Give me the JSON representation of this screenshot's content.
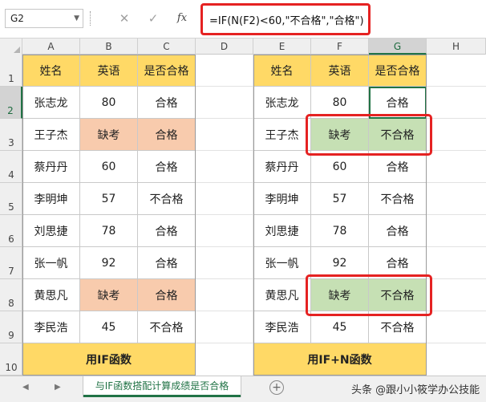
{
  "formula_bar": {
    "name_box": "G2",
    "cancel_glyph": "✕",
    "confirm_glyph": "✓",
    "fx_label": "fx",
    "formula": "=IF(N(F2)<60,\"不合格\",\"合格\")"
  },
  "columns": [
    "A",
    "B",
    "C",
    "D",
    "E",
    "F",
    "G",
    "H"
  ],
  "selected_column": "G",
  "rows": [
    "1",
    "2",
    "3",
    "4",
    "5",
    "6",
    "7",
    "8",
    "9",
    "10"
  ],
  "selected_row": "2",
  "left_table": {
    "headers": [
      "姓名",
      "英语",
      "是否合格"
    ],
    "rows": [
      [
        "张志龙",
        "80",
        "合格"
      ],
      [
        "王子杰",
        "缺考",
        "合格"
      ],
      [
        "蔡丹丹",
        "60",
        "合格"
      ],
      [
        "李明坤",
        "57",
        "不合格"
      ],
      [
        "刘思捷",
        "78",
        "合格"
      ],
      [
        "张一帆",
        "92",
        "合格"
      ],
      [
        "黄思凡",
        "缺考",
        "合格"
      ],
      [
        "李民浩",
        "45",
        "不合格"
      ]
    ],
    "footer": "用IF函数",
    "highlight_color": "#f8cbad"
  },
  "right_table": {
    "headers": [
      "姓名",
      "英语",
      "是否合格"
    ],
    "rows": [
      [
        "张志龙",
        "80",
        "合格"
      ],
      [
        "王子杰",
        "缺考",
        "不合格"
      ],
      [
        "蔡丹丹",
        "60",
        "合格"
      ],
      [
        "李明坤",
        "57",
        "不合格"
      ],
      [
        "刘思捷",
        "78",
        "合格"
      ],
      [
        "张一帆",
        "92",
        "合格"
      ],
      [
        "黄思凡",
        "缺考",
        "不合格"
      ],
      [
        "李民浩",
        "45",
        "不合格"
      ]
    ],
    "footer": "用IF+N函数",
    "highlight_color": "#c6e0b4"
  },
  "colors": {
    "header_fill": "#ffd966",
    "annotation_red": "#e52222",
    "excel_green": "#217346"
  },
  "tab_bar": {
    "sheet_name": "与IF函数搭配计算成绩是否合格",
    "add_glyph": "+",
    "prev_glyph": "◀",
    "next_glyph": "▶",
    "watermark": "头条 @跟小小筱学办公技能"
  }
}
